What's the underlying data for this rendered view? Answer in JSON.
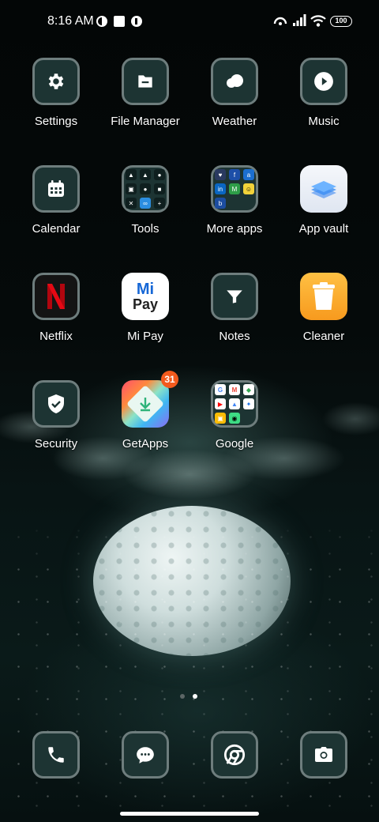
{
  "status_bar": {
    "time": "8:16 AM",
    "battery": "100"
  },
  "apps": [
    {
      "label": "Settings",
      "icon": "gear-icon"
    },
    {
      "label": "File Manager",
      "icon": "folder-icon"
    },
    {
      "label": "Weather",
      "icon": "cloud-icon"
    },
    {
      "label": "Music",
      "icon": "play-icon"
    },
    {
      "label": "Calendar",
      "icon": "calendar-icon"
    },
    {
      "label": "Tools",
      "icon": "folder-grid-icon"
    },
    {
      "label": "More apps",
      "icon": "folder-grid-icon"
    },
    {
      "label": "App vault",
      "icon": "layers-icon"
    },
    {
      "label": "Netflix",
      "icon": "netflix-n-icon"
    },
    {
      "label": "Mi Pay",
      "icon": "mi-pay-logo"
    },
    {
      "label": "Notes",
      "icon": "funnel-icon"
    },
    {
      "label": "Cleaner",
      "icon": "trash-can-icon"
    },
    {
      "label": "Security",
      "icon": "shield-check-icon"
    },
    {
      "label": "GetApps",
      "icon": "download-arrow-icon",
      "badge": "31"
    },
    {
      "label": "Google",
      "icon": "folder-grid-icon"
    }
  ],
  "mi_pay_logo_text": {
    "line1": "Mi",
    "line2": "Pay"
  },
  "page_indicator": {
    "pages": 2,
    "active": 2
  },
  "dock": [
    {
      "name": "Phone",
      "icon": "phone-icon"
    },
    {
      "name": "Messages",
      "icon": "chat-bubble-icon"
    },
    {
      "name": "Chrome",
      "icon": "chrome-icon"
    },
    {
      "name": "Camera",
      "icon": "camera-icon"
    }
  ],
  "colors": {
    "tile_bg": "#1d3433",
    "tile_border": "#6e7d7d",
    "badge": "#f25a1d",
    "netflix_red": "#e50914",
    "cleaner_orange": "#f7a42a"
  }
}
